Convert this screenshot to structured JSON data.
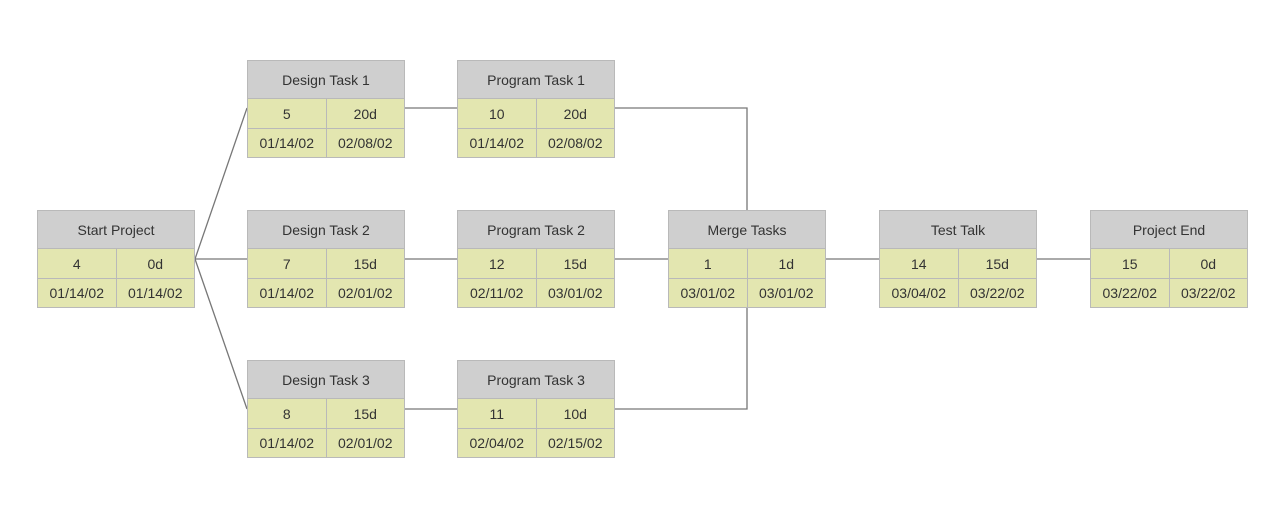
{
  "colors": {
    "header": "#cfcfcf",
    "cell": "#e3e6b0",
    "border": "#b9b9b9",
    "link": "#777777"
  },
  "nodes": [
    {
      "title": "Start Project",
      "id": "4",
      "duration": "0d",
      "start": "01/14/02",
      "finish": "01/14/02"
    },
    {
      "title": "Design Task 1",
      "id": "5",
      "duration": "20d",
      "start": "01/14/02",
      "finish": "02/08/02"
    },
    {
      "title": "Design Task 2",
      "id": "7",
      "duration": "15d",
      "start": "01/14/02",
      "finish": "02/01/02"
    },
    {
      "title": "Design Task 3",
      "id": "8",
      "duration": "15d",
      "start": "01/14/02",
      "finish": "02/01/02"
    },
    {
      "title": "Program Task 1",
      "id": "10",
      "duration": "20d",
      "start": "01/14/02",
      "finish": "02/08/02"
    },
    {
      "title": "Program Task 2",
      "id": "12",
      "duration": "15d",
      "start": "02/11/02",
      "finish": "03/01/02"
    },
    {
      "title": "Program Task 3",
      "id": "11",
      "duration": "10d",
      "start": "02/04/02",
      "finish": "02/15/02"
    },
    {
      "title": "Merge Tasks",
      "id": "1",
      "duration": "1d",
      "start": "03/01/02",
      "finish": "03/01/02"
    },
    {
      "title": "Test Talk",
      "id": "14",
      "duration": "15d",
      "start": "03/04/02",
      "finish": "03/22/02"
    },
    {
      "title": "Project End",
      "id": "15",
      "duration": "0d",
      "start": "03/22/02",
      "finish": "03/22/02"
    }
  ],
  "links": [
    [
      "Start Project",
      "Design Task 1"
    ],
    [
      "Start Project",
      "Design Task 2"
    ],
    [
      "Start Project",
      "Design Task 3"
    ],
    [
      "Design Task 1",
      "Program Task 1"
    ],
    [
      "Design Task 2",
      "Program Task 2"
    ],
    [
      "Design Task 3",
      "Program Task 3"
    ],
    [
      "Program Task 1",
      "Merge Tasks"
    ],
    [
      "Program Task 2",
      "Merge Tasks"
    ],
    [
      "Program Task 3",
      "Merge Tasks"
    ],
    [
      "Merge Tasks",
      "Test Talk"
    ],
    [
      "Test Talk",
      "Project End"
    ]
  ]
}
